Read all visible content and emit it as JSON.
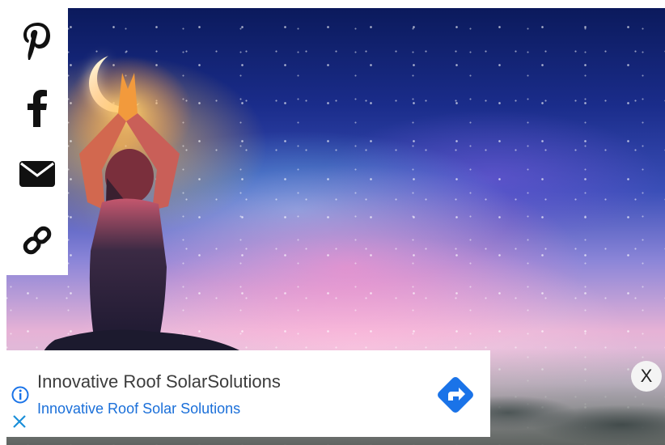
{
  "share_bar": {
    "items": [
      {
        "icon": "pinterest-icon"
      },
      {
        "icon": "facebook-icon"
      },
      {
        "icon": "email-icon"
      },
      {
        "icon": "link-icon"
      }
    ]
  },
  "ad": {
    "headline": "Innovative Roof SolarSolutions",
    "advertiser": "Innovative Roof Solar Solutions",
    "info_icon": "info-icon",
    "close_icon": "close-icon",
    "cta_icon": "directions-arrow-icon",
    "accent_color": "#1a73e8"
  },
  "dismiss": {
    "label": "X"
  }
}
